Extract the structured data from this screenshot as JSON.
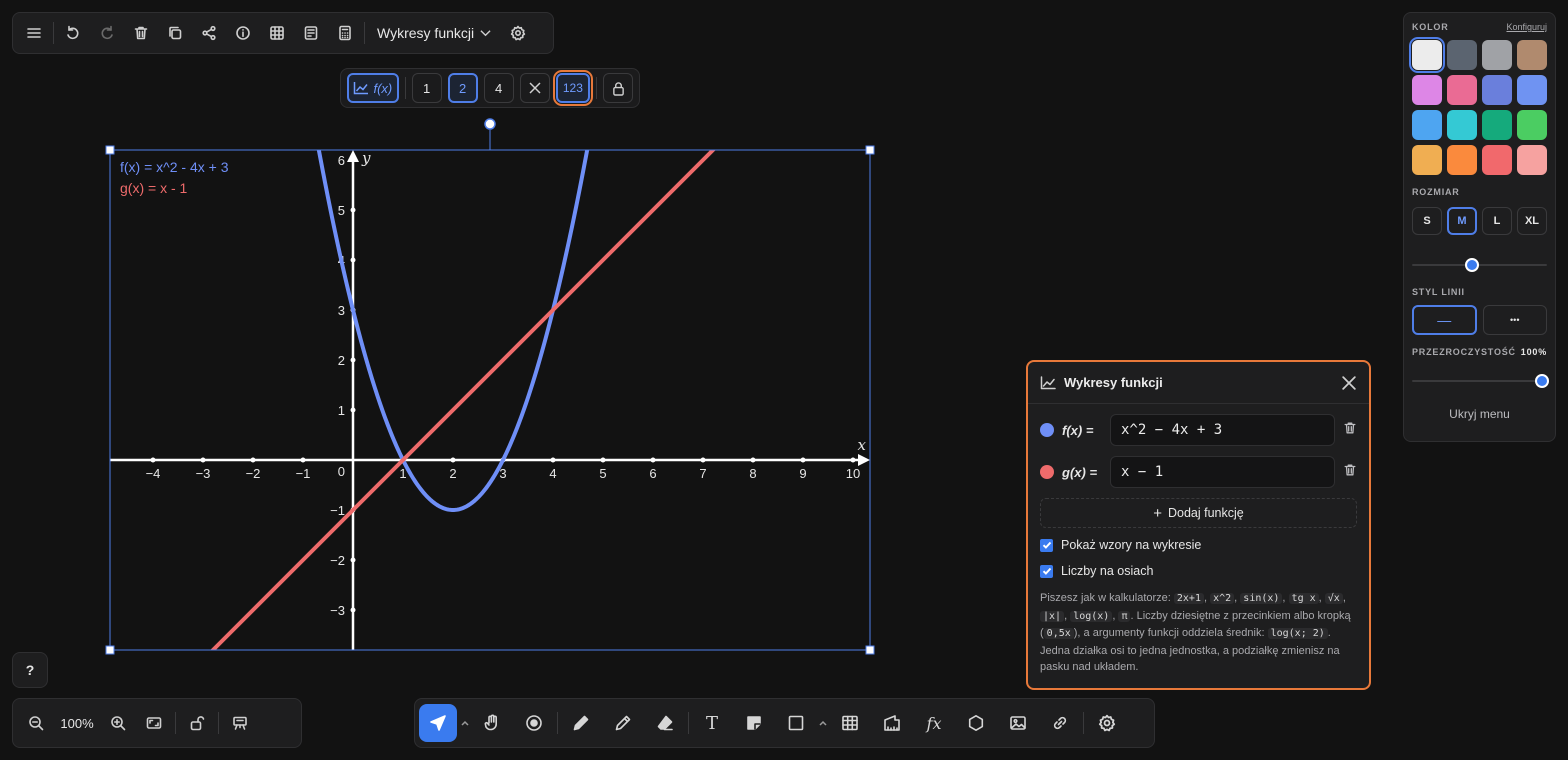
{
  "top_toolbar": {
    "title": "Wykresy funkcji",
    "icons": [
      "menu-icon",
      "undo-icon",
      "redo-icon",
      "trash-icon",
      "duplicate-icon",
      "share-icon",
      "info-icon",
      "table-icon",
      "notes-icon",
      "calculator-icon",
      "chevron-down-icon",
      "gear-icon"
    ]
  },
  "graph_toolbar": {
    "fx_label": "f(x)",
    "scale_options": [
      "1",
      "2",
      "4"
    ],
    "selected_scale": "2",
    "numbers_label": "123"
  },
  "graph": {
    "legend": [
      {
        "text": "f(x) = x^2 - 4x + 3",
        "color": "#6f8ff7"
      },
      {
        "text": "g(x) = x - 1",
        "color": "#ee6b6b"
      }
    ],
    "x_axis_label": "x",
    "y_axis_label": "y",
    "x_ticks": [
      "−4",
      "−3",
      "−2",
      "−1",
      "1",
      "2",
      "3",
      "4",
      "5",
      "6",
      "7",
      "8",
      "9",
      "10"
    ],
    "y_ticks": [
      "6",
      "5",
      "4",
      "3",
      "2",
      "1",
      "−1",
      "−2",
      "−3"
    ],
    "origin_label": "0"
  },
  "chart_data": {
    "type": "line",
    "xlim": [
      -4.8,
      10.4
    ],
    "ylim": [
      -3.8,
      6.2
    ],
    "series": [
      {
        "name": "f(x) = x^2 - 4x + 3",
        "expression": "x^2 - 4x + 3",
        "color": "#6f8ff7"
      },
      {
        "name": "g(x) = x - 1",
        "expression": "x - 1",
        "color": "#ee6b6b"
      }
    ],
    "xlabel": "x",
    "ylabel": "y"
  },
  "style_panel": {
    "color_label": "KOLOR",
    "configure_link": "Konfiguruj",
    "colors": [
      "#ececec",
      "#5b6470",
      "#a0a2a6",
      "#b08a6e",
      "#dd86e6",
      "#ea6b94",
      "#6a7fdc",
      "#6f93f2",
      "#4ea5f1",
      "#34c9d4",
      "#15aa7c",
      "#4bcd62",
      "#f0ae52",
      "#fa8a3d",
      "#f1696c",
      "#f6a2a0"
    ],
    "selected_color": 0,
    "size_label": "ROZMIAR",
    "sizes": [
      "S",
      "M",
      "L",
      "XL"
    ],
    "selected_size": "M",
    "size_slider": 0.43,
    "line_style_label": "STYL LINII",
    "line_styles": [
      "—",
      "•••"
    ],
    "opacity_label": "PRZEZROCZYSTOŚĆ",
    "opacity_value": "100%",
    "opacity_slider": 1.0,
    "hide_menu": "Ukryj menu"
  },
  "functions_dialog": {
    "title": "Wykresy funkcji",
    "functions": [
      {
        "label": "f(x) =",
        "value": "x^2 − 4x + 3",
        "color": "#6f8ff7"
      },
      {
        "label": "g(x) =",
        "value": "x − 1",
        "color": "#ee6b6b"
      }
    ],
    "add_function": "Dodaj funkcję",
    "show_formulas": "Pokaż wzory na wykresie",
    "axis_numbers": "Liczby na osiach",
    "help": {
      "p1": "Piszesz jak w kalkulatorze:",
      "codes1": [
        "2x+1",
        "x^2",
        "sin(x)",
        "tg x",
        "√x",
        "|x|",
        "log(x)",
        "π"
      ],
      "p2": ". Liczby dziesiętne z przecinkiem albo kropką (",
      "code2": "0,5x",
      "p3": "), a argumenty funkcji oddziela średnik:",
      "code3": "log(x; 2)",
      "p4": ". Jedna działka osi to jedna jednostka, a podziałkę zmienisz na pasku nad układem."
    }
  },
  "help_button": "?",
  "zoom": {
    "value": "100%"
  }
}
